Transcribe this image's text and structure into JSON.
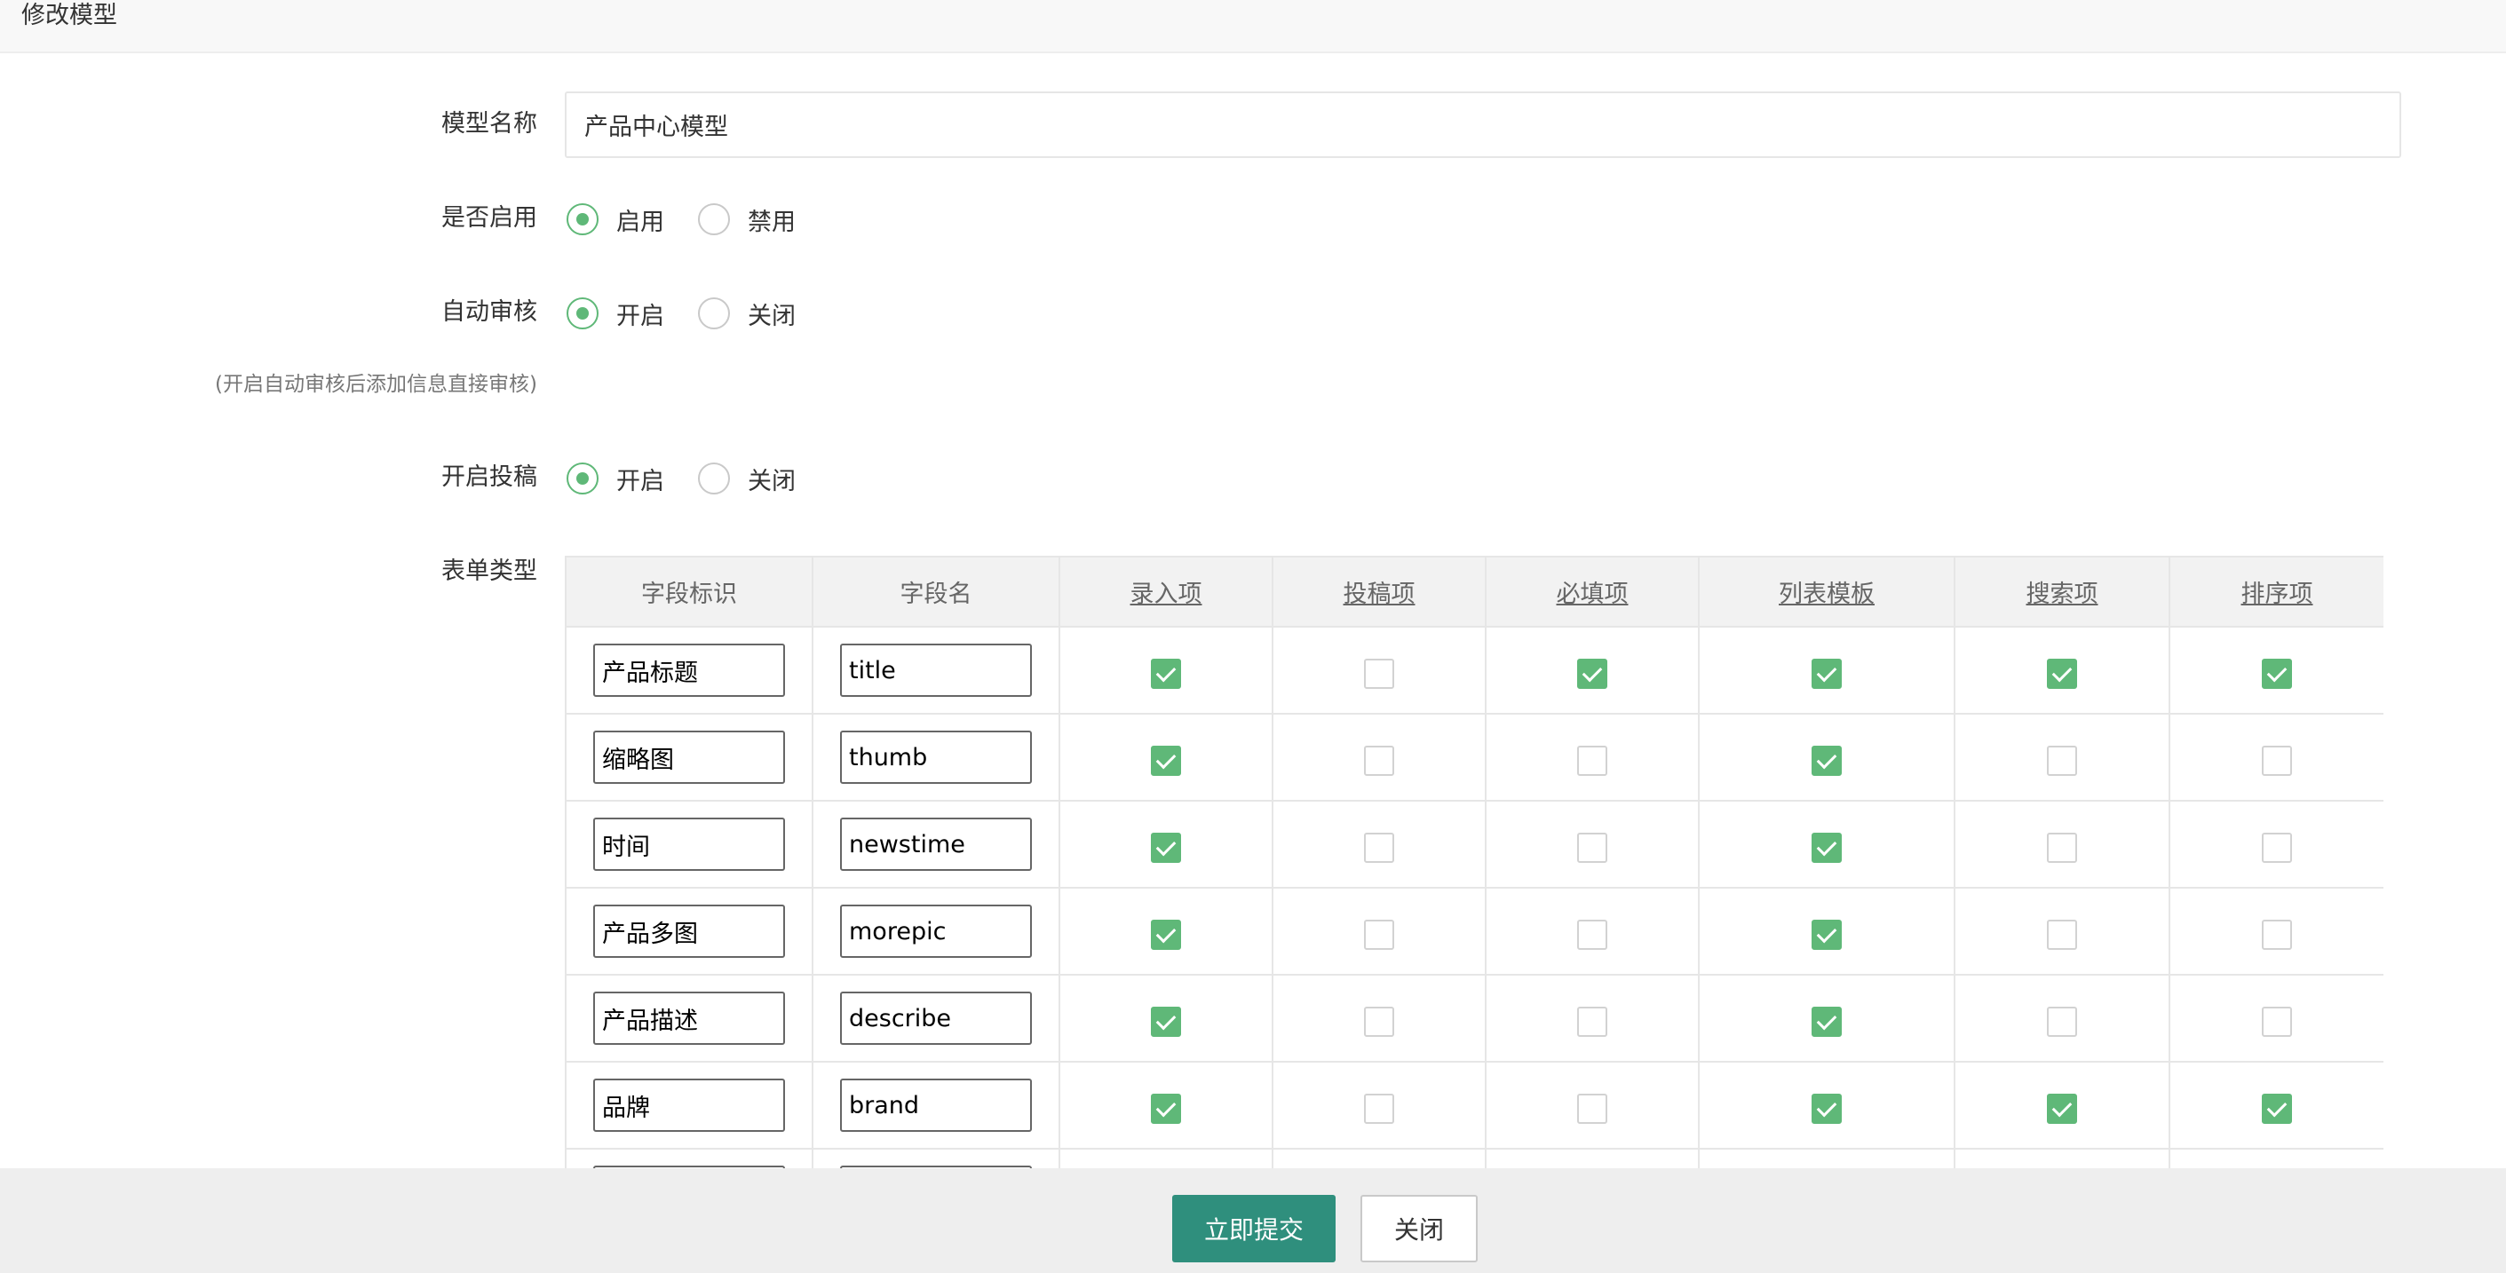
{
  "window": {
    "title": "修改模型"
  },
  "form": {
    "model_name": {
      "label": "模型名称",
      "value": "产品中心模型"
    },
    "enabled": {
      "label": "是否启用",
      "options": [
        "启用",
        "禁用"
      ],
      "selected": "启用"
    },
    "auto_review": {
      "label": "自动审核",
      "options": [
        "开启",
        "关闭"
      ],
      "selected": "开启",
      "hint": "(开启自动审核后添加信息直接审核)"
    },
    "submission": {
      "label": "开启投稿",
      "options": [
        "开启",
        "关闭"
      ],
      "selected": "开启"
    },
    "form_type": {
      "label": "表单类型",
      "columns": [
        "字段标识",
        "字段名",
        "录入项",
        "投稿项",
        "必填项",
        "列表模板",
        "搜索项",
        "排序项"
      ],
      "rows": [
        {
          "label": "产品标题",
          "name": "title",
          "input": true,
          "submit": false,
          "required": true,
          "list": true,
          "search": true,
          "sort": true
        },
        {
          "label": "缩略图",
          "name": "thumb",
          "input": true,
          "submit": false,
          "required": false,
          "list": true,
          "search": false,
          "sort": false
        },
        {
          "label": "时间",
          "name": "newstime",
          "input": true,
          "submit": false,
          "required": false,
          "list": true,
          "search": false,
          "sort": false
        },
        {
          "label": "产品多图",
          "name": "morepic",
          "input": true,
          "submit": false,
          "required": false,
          "list": true,
          "search": false,
          "sort": false
        },
        {
          "label": "产品描述",
          "name": "describe",
          "input": true,
          "submit": false,
          "required": false,
          "list": true,
          "search": false,
          "sort": false
        },
        {
          "label": "品牌",
          "name": "brand",
          "input": true,
          "submit": false,
          "required": false,
          "list": true,
          "search": true,
          "sort": true
        },
        {
          "label": "",
          "name": "",
          "input": false,
          "submit": false,
          "required": false,
          "list": false,
          "search": false,
          "sort": false
        }
      ]
    }
  },
  "footer": {
    "submit_label": "立即提交",
    "close_label": "关闭"
  },
  "colors": {
    "accent_green": "#5fb878",
    "primary_button": "#2f8f7d"
  }
}
